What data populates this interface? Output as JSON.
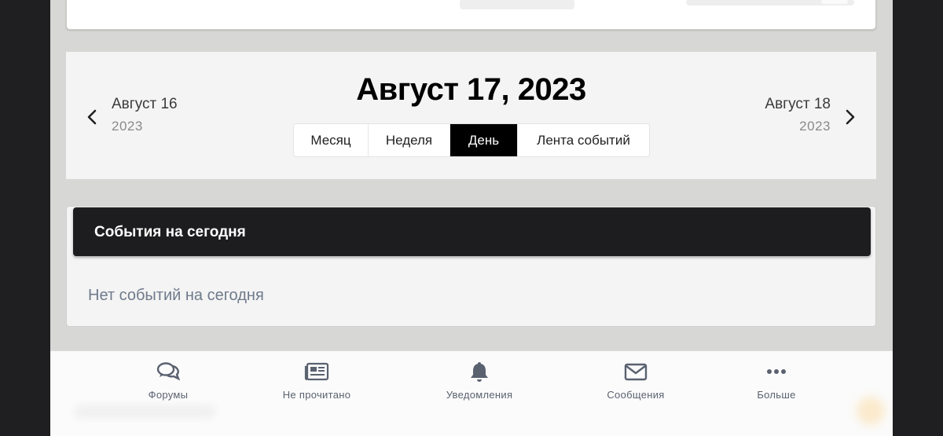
{
  "calendar": {
    "title": "Август 17, 2023",
    "prev": {
      "date": "Август 16",
      "year": "2023",
      "icon": "chevron-left-icon"
    },
    "next": {
      "date": "Август 18",
      "year": "2023",
      "icon": "chevron-right-icon"
    },
    "views": [
      {
        "label": "Месяц",
        "active": false
      },
      {
        "label": "Неделя",
        "active": false
      },
      {
        "label": "День",
        "active": true
      },
      {
        "label": "Лента событий",
        "active": false
      }
    ]
  },
  "events": {
    "heading": "События на сегодня",
    "empty_text": "Нет событий на сегодня"
  },
  "bottom_nav": [
    {
      "label": "Форумы",
      "icon": "forums-icon"
    },
    {
      "label": "Не прочитано",
      "icon": "newspaper-icon"
    },
    {
      "label": "Уведомления",
      "icon": "bell-icon"
    },
    {
      "label": "Сообщения",
      "icon": "envelope-icon"
    },
    {
      "label": "Больше",
      "icon": "more-icon"
    }
  ],
  "colors": {
    "active_tab": "#000000",
    "events_header": "#1d1d1f",
    "nav_icon": "#5a6270",
    "page_bg": "#d7d8d6"
  }
}
